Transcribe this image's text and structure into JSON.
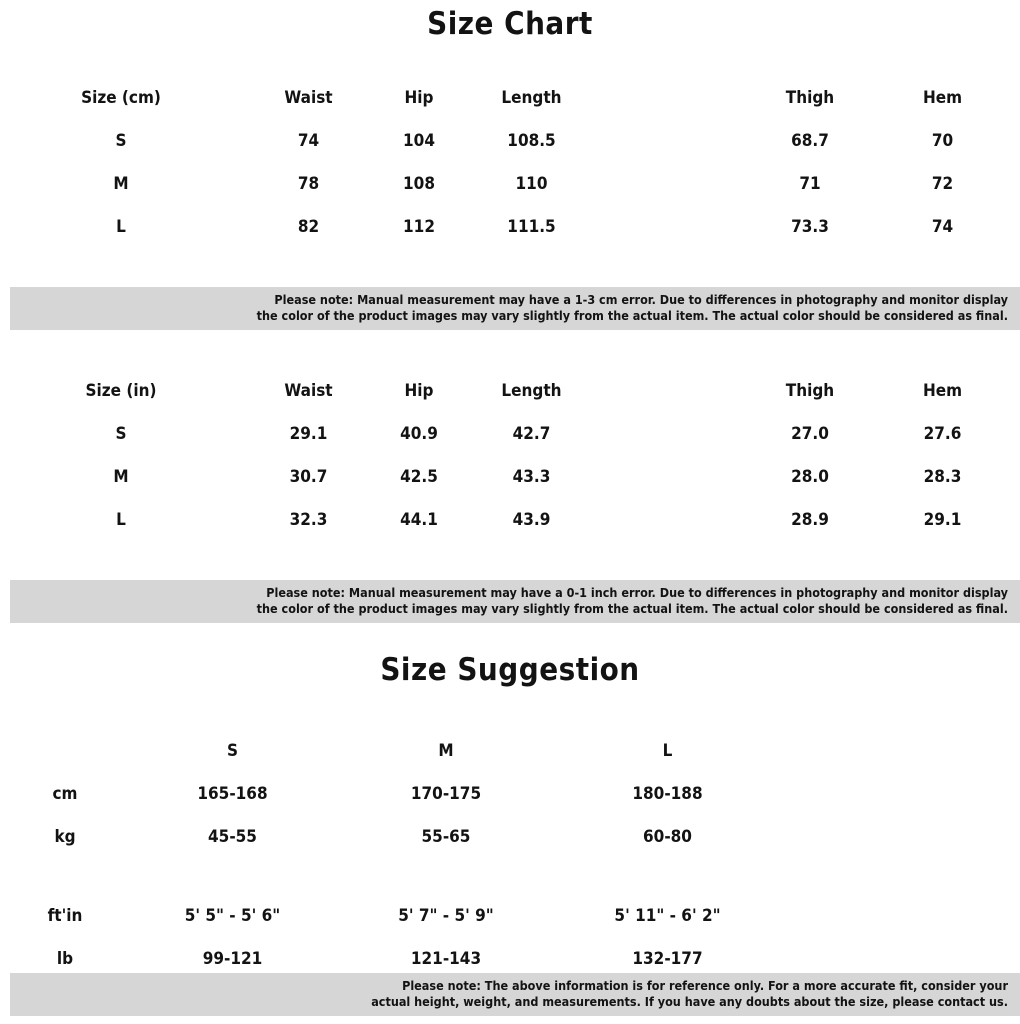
{
  "titles": {
    "size_chart": "Size Chart",
    "size_suggestion": "Size Suggestion"
  },
  "colors": {
    "note_band_background": "#d6d6d6",
    "text": "#131313",
    "page_background": "#ffffff"
  },
  "table_cm": {
    "headers": [
      "Size (cm)",
      "Waist",
      "Hip",
      "Length",
      "Thigh",
      "Hem"
    ],
    "rows": [
      {
        "size": "S",
        "waist": "74",
        "hip": "104",
        "length": "108.5",
        "thigh": "68.7",
        "hem": "70"
      },
      {
        "size": "M",
        "waist": "78",
        "hip": "108",
        "length": "110",
        "thigh": "71",
        "hem": "72"
      },
      {
        "size": "L",
        "waist": "82",
        "hip": "112",
        "length": "111.5",
        "thigh": "73.3",
        "hem": "74"
      }
    ]
  },
  "note_cm": {
    "line1": "Please note: Manual measurement may have a 1-3 cm error. Due to differences in photography and monitor display",
    "line2": "the color of the product images may vary slightly from the actual item. The actual color should be considered as final."
  },
  "table_in": {
    "headers": [
      "Size (in)",
      "Waist",
      "Hip",
      "Length",
      "Thigh",
      "Hem"
    ],
    "rows": [
      {
        "size": "S",
        "waist": "29.1",
        "hip": "40.9",
        "length": "42.7",
        "thigh": "27.0",
        "hem": "27.6"
      },
      {
        "size": "M",
        "waist": "30.7",
        "hip": "42.5",
        "length": "43.3",
        "thigh": "28.0",
        "hem": "28.3"
      },
      {
        "size": "L",
        "waist": "32.3",
        "hip": "44.1",
        "length": "43.9",
        "thigh": "28.9",
        "hem": "29.1"
      }
    ]
  },
  "note_in": {
    "line1": "Please note: Manual measurement may have a 0-1 inch error. Due to differences in photography and monitor display",
    "line2": "the color of the product images may vary slightly from the actual item. The actual color should be considered as final."
  },
  "table_suggestion": {
    "headers": [
      "",
      "S",
      "M",
      "L"
    ],
    "rows": [
      {
        "label": "cm",
        "s": "165-168",
        "m": "170-175",
        "l": "180-188"
      },
      {
        "label": "kg",
        "s": "45-55",
        "m": "55-65",
        "l": "60-80"
      },
      {
        "label": "ft'in",
        "s": "5' 5\" - 5' 6\"",
        "m": "5' 7\" - 5' 9\"",
        "l": "5' 11\" - 6' 2\""
      },
      {
        "label": "lb",
        "s": "99-121",
        "m": "121-143",
        "l": "132-177"
      }
    ]
  },
  "note_reference": {
    "line1": "Please note: The above information is for reference only. For a more accurate fit, consider your",
    "line2": "actual height, weight, and measurements. If you have any doubts about the size, please contact us."
  },
  "chart_data": {
    "type": "table",
    "title": "Size Chart",
    "tables": [
      {
        "name": "measurements_cm",
        "unit": "cm",
        "columns": [
          "Size (cm)",
          "Waist",
          "Hip",
          "Length",
          "Thigh",
          "Hem"
        ],
        "rows": [
          [
            "S",
            74,
            104,
            108.5,
            68.7,
            70
          ],
          [
            "M",
            78,
            108,
            110,
            71,
            72
          ],
          [
            "L",
            82,
            112,
            111.5,
            73.3,
            74
          ]
        ]
      },
      {
        "name": "measurements_in",
        "unit": "in",
        "columns": [
          "Size (in)",
          "Waist",
          "Hip",
          "Length",
          "Thigh",
          "Hem"
        ],
        "rows": [
          [
            "S",
            29.1,
            40.9,
            42.7,
            27.0,
            27.6
          ],
          [
            "M",
            30.7,
            42.5,
            43.3,
            28.0,
            28.3
          ],
          [
            "L",
            32.3,
            44.1,
            43.9,
            28.9,
            29.1
          ]
        ]
      },
      {
        "name": "size_suggestion",
        "columns": [
          "",
          "S",
          "M",
          "L"
        ],
        "rows": [
          [
            "cm",
            "165-168",
            "170-175",
            "180-188"
          ],
          [
            "kg",
            "45-55",
            "55-65",
            "60-80"
          ],
          [
            "ft'in",
            "5' 5\" - 5' 6\"",
            "5' 7\" - 5' 9\"",
            "5' 11\" - 6' 2\""
          ],
          [
            "lb",
            "99-121",
            "121-143",
            "132-177"
          ]
        ]
      }
    ]
  }
}
